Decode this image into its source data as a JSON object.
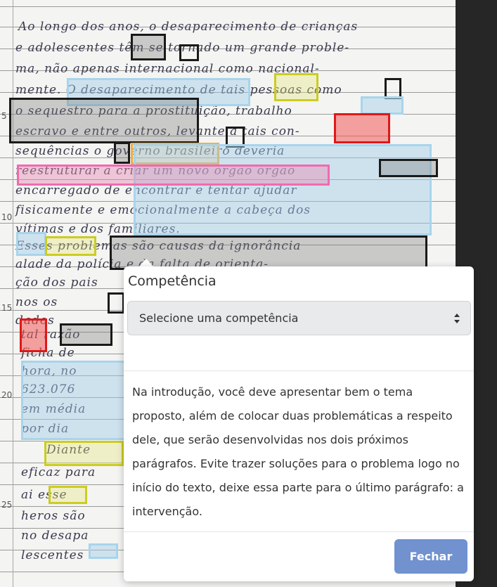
{
  "essay": {
    "line_numbers": [
      "5",
      "10",
      "15",
      "20",
      "25"
    ],
    "handwritten_lines": [
      "Ao longo dos anos, o desaparecimento de crianças",
      "e adolescentes têm se tornado um grande proble-",
      "ma, não apenas internacional como nacional-",
      "mente. O desaparecimento de tais pessoas como",
      "o sequestro para a prostituição, trabalho",
      "escravo e entre outros, levante a tais con-",
      "sequências o governo brasileiro deveria",
      "reestruturar a criar um novo órgão órgão",
      "encarregado de encontrar e tentar ajudar",
      "fisicamente e emocionalmente a cabeça dos",
      "vítimas e dos familiares.",
      "Esses problemas são causas da ignorância",
      "alade da polícia e da falta de orienta-",
      "ção dos pais",
      "nos os",
      "dados",
      "tal razão",
      "ficha de",
      "hora, no",
      "623.076",
      "em média",
      "por dia",
      "Diante",
      "eficaz para",
      "ai esse",
      "heros são",
      "no desapa",
      "lescentes"
    ]
  },
  "popover": {
    "title": "Competência",
    "select_placeholder": "Selecione uma competência",
    "body": "Na introdução, você deve apresentar bem o tema proposto, além de colocar duas problemáticas a respeito dele, que serão desenvolvidas nos dois próximos parágrafos. Evite trazer soluções para o problema logo no início do texto, deixe essa parte para o último parágrafo: a intervenção.",
    "close_label": "Fechar"
  },
  "icons": {
    "select_caret": "select-caret-icon"
  },
  "colors": {
    "highlight_black": "#1a1a1a",
    "highlight_yellow": "#cccc22",
    "highlight_red": "#e01818",
    "highlight_blue": "#a8d4ec",
    "highlight_pink": "#f06ab0",
    "highlight_orange": "#f0b040",
    "button": "#7191cf"
  }
}
